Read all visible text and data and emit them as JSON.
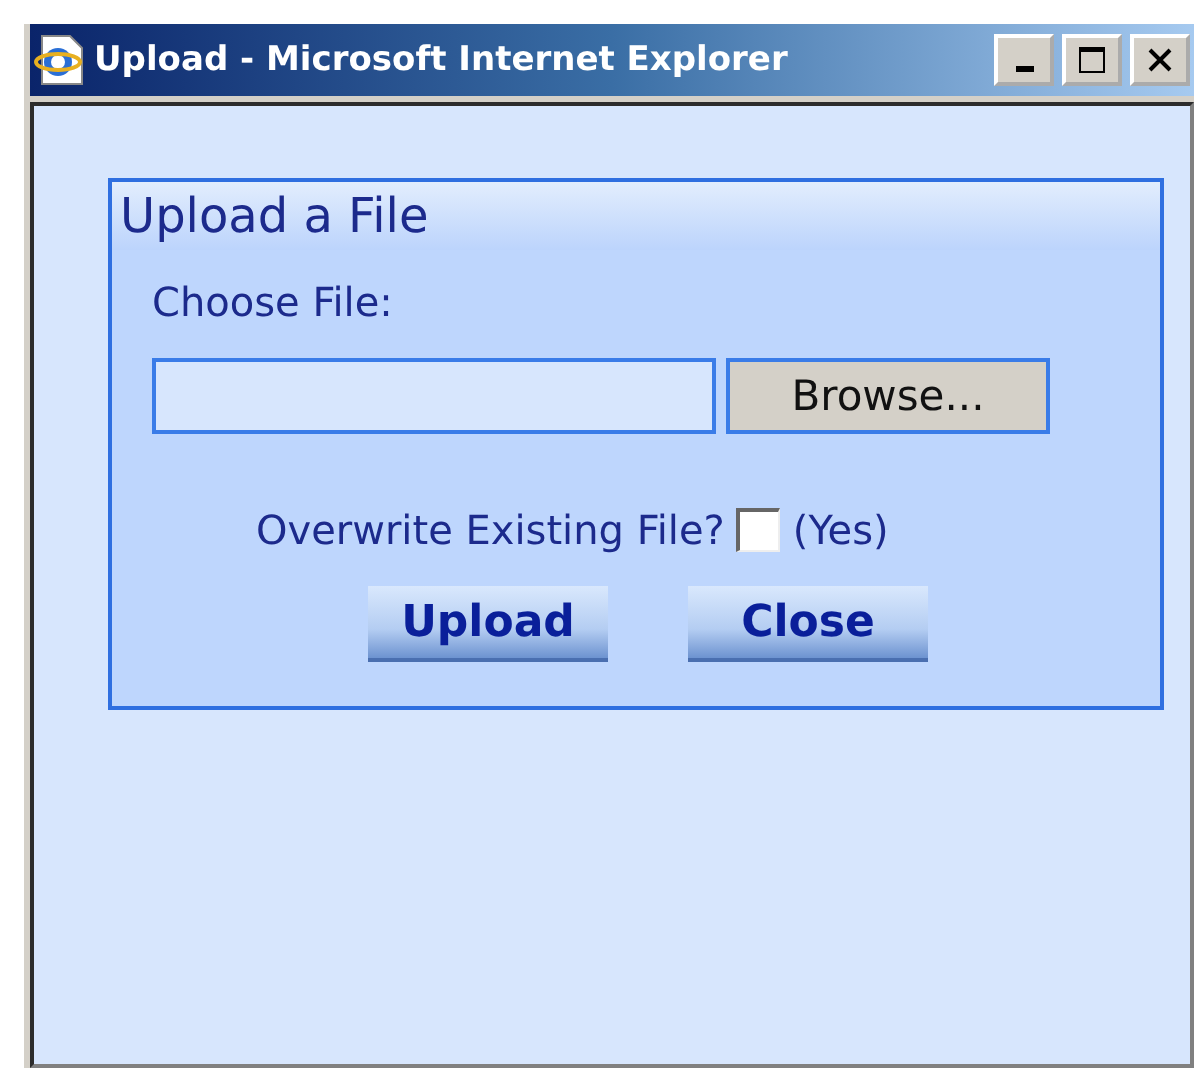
{
  "window": {
    "title": "Upload - Microsoft Internet Explorer"
  },
  "panel": {
    "title": "Upload a File",
    "file_label": "Choose File:",
    "browse_button": "Browse...",
    "overwrite": {
      "label": "Overwrite Existing File?",
      "checked": false,
      "option": "(Yes)"
    },
    "buttons": [
      "Upload",
      "Close"
    ]
  }
}
